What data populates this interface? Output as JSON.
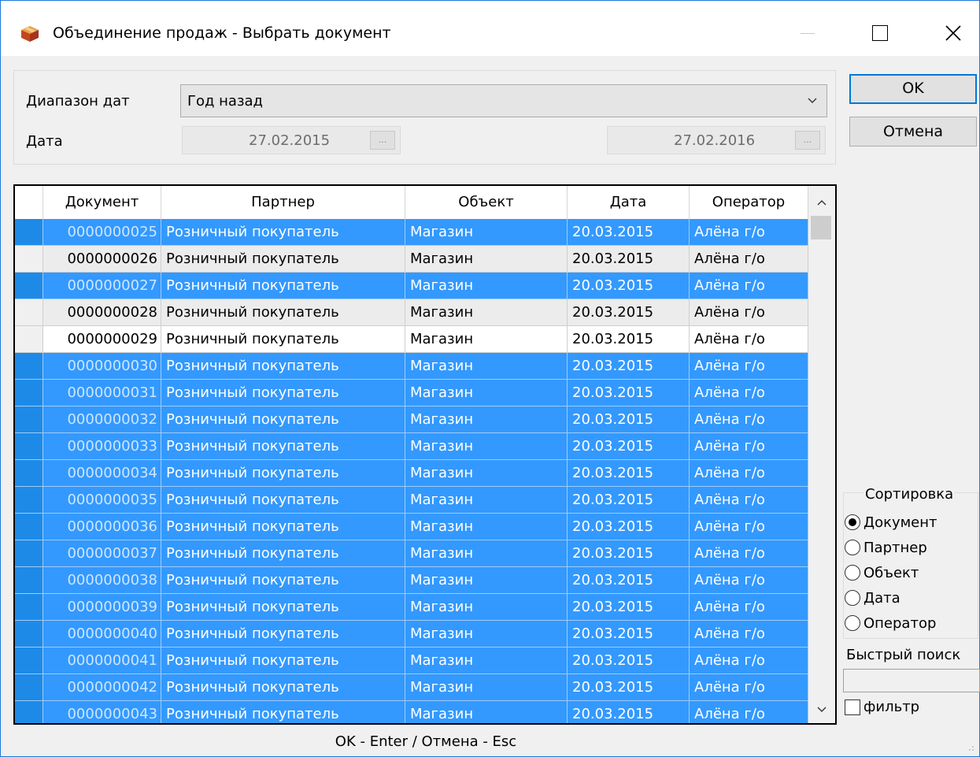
{
  "window": {
    "title": "Объединение продаж - Выбрать документ",
    "icon": "box-icon"
  },
  "filter": {
    "range_label": "Диапазон дат",
    "range_value": "Год назад",
    "date_label": "Дата",
    "date_from": "27.02.2015",
    "date_to": "27.02.2016",
    "date_button": "..."
  },
  "buttons": {
    "ok": "OK",
    "cancel": "Отмена"
  },
  "table": {
    "columns": [
      "Документ",
      "Партнер",
      "Объект",
      "Дата",
      "Оператор"
    ],
    "rows": [
      {
        "doc": "0000000025",
        "partner": "Розничный покупатель",
        "object": "Магазин",
        "date": "20.03.2015",
        "operator": "Алёна г/о",
        "state": "sel"
      },
      {
        "doc": "0000000026",
        "partner": "Розничный покупатель",
        "object": "Магазин",
        "date": "20.03.2015",
        "operator": "Алёна г/о",
        "state": "gray"
      },
      {
        "doc": "0000000027",
        "partner": "Розничный покупатель",
        "object": "Магазин",
        "date": "20.03.2015",
        "operator": "Алёна г/о",
        "state": "sel"
      },
      {
        "doc": "0000000028",
        "partner": "Розничный покупатель",
        "object": "Магазин",
        "date": "20.03.2015",
        "operator": "Алёна г/о",
        "state": "gray"
      },
      {
        "doc": "0000000029",
        "partner": "Розничный покупатель",
        "object": "Магазин",
        "date": "20.03.2015",
        "operator": "Алёна г/о",
        "state": "white"
      },
      {
        "doc": "0000000030",
        "partner": "Розничный покупатель",
        "object": "Магазин",
        "date": "20.03.2015",
        "operator": "Алёна г/о",
        "state": "sel"
      },
      {
        "doc": "0000000031",
        "partner": "Розничный покупатель",
        "object": "Магазин",
        "date": "20.03.2015",
        "operator": "Алёна г/о",
        "state": "sel"
      },
      {
        "doc": "0000000032",
        "partner": "Розничный покупатель",
        "object": "Магазин",
        "date": "20.03.2015",
        "operator": "Алёна г/о",
        "state": "sel"
      },
      {
        "doc": "0000000033",
        "partner": "Розничный покупатель",
        "object": "Магазин",
        "date": "20.03.2015",
        "operator": "Алёна г/о",
        "state": "sel"
      },
      {
        "doc": "0000000034",
        "partner": "Розничный покупатель",
        "object": "Магазин",
        "date": "20.03.2015",
        "operator": "Алёна г/о",
        "state": "sel"
      },
      {
        "doc": "0000000035",
        "partner": "Розничный покупатель",
        "object": "Магазин",
        "date": "20.03.2015",
        "operator": "Алёна г/о",
        "state": "sel"
      },
      {
        "doc": "0000000036",
        "partner": "Розничный покупатель",
        "object": "Магазин",
        "date": "20.03.2015",
        "operator": "Алёна г/о",
        "state": "sel"
      },
      {
        "doc": "0000000037",
        "partner": "Розничный покупатель",
        "object": "Магазин",
        "date": "20.03.2015",
        "operator": "Алёна г/о",
        "state": "sel"
      },
      {
        "doc": "0000000038",
        "partner": "Розничный покупатель",
        "object": "Магазин",
        "date": "20.03.2015",
        "operator": "Алёна г/о",
        "state": "sel"
      },
      {
        "doc": "0000000039",
        "partner": "Розничный покупатель",
        "object": "Магазин",
        "date": "20.03.2015",
        "operator": "Алёна г/о",
        "state": "sel"
      },
      {
        "doc": "0000000040",
        "partner": "Розничный покупатель",
        "object": "Магазин",
        "date": "20.03.2015",
        "operator": "Алёна г/о",
        "state": "sel"
      },
      {
        "doc": "0000000041",
        "partner": "Розничный покупатель",
        "object": "Магазин",
        "date": "20.03.2015",
        "operator": "Алёна г/о",
        "state": "sel"
      },
      {
        "doc": "0000000042",
        "partner": "Розничный покупатель",
        "object": "Магазин",
        "date": "20.03.2015",
        "operator": "Алёна г/о",
        "state": "sel"
      },
      {
        "doc": "0000000043",
        "partner": "Розничный покупатель",
        "object": "Магазин",
        "date": "20.03.2015",
        "operator": "Алёна г/о",
        "state": "sel"
      }
    ]
  },
  "sort": {
    "legend": "Сортировка",
    "options": [
      "Документ",
      "Партнер",
      "Объект",
      "Дата",
      "Оператор"
    ],
    "selected": "Документ"
  },
  "quick_search": {
    "label": "Быстрый поиск",
    "value": ""
  },
  "filter_checkbox": {
    "label": "фильтр",
    "checked": false
  },
  "hint": "OK - Enter / Отмена - Esc",
  "colors": {
    "selection": "#3399ff",
    "accent": "#0078d7"
  }
}
